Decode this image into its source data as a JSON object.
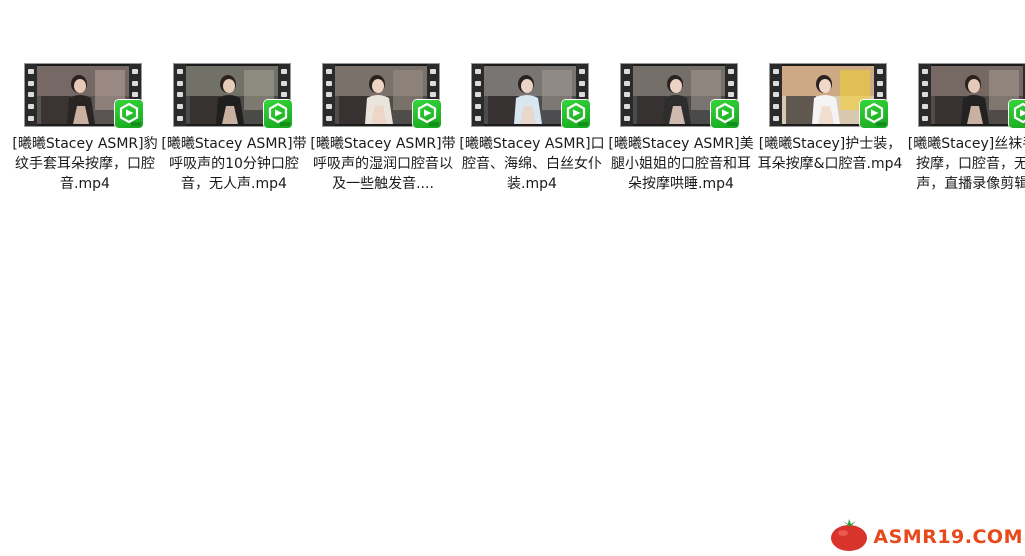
{
  "files": [
    {
      "name": "[曦曦Stacey ASMR]豹纹手套耳朵按摩，口腔音.mp4",
      "icon": "video-thumbnail"
    },
    {
      "name": "[曦曦Stacey ASMR]带呼吸声的10分钟口腔音，无人声.mp4",
      "icon": "video-thumbnail"
    },
    {
      "name": "[曦曦Stacey ASMR]带呼吸声的湿润口腔音以及一些触发音....",
      "icon": "video-thumbnail"
    },
    {
      "name": "[曦曦Stacey ASMR]口腔音、海绵、白丝女仆装.mp4",
      "icon": "video-thumbnail"
    },
    {
      "name": "[曦曦Stacey ASMR]美腿小姐姐的口腔音和耳朵按摩哄睡.mp4",
      "icon": "video-thumbnail"
    },
    {
      "name": "[曦曦Stacey]护士装，耳朵按摩&口腔音.mp4",
      "icon": "video-thumbnail"
    },
    {
      "name": "[曦曦Stacey]丝袜手套按摩，口腔音，无人声，直播录像剪辑...",
      "icon": "video-thumbnail"
    }
  ],
  "watermark": {
    "text": "ASMR19.COM",
    "icon": "tomato-logo-icon",
    "color": "#e8491b"
  },
  "colors": {
    "badge_green": "#22b52a",
    "background": "#ffffff"
  }
}
